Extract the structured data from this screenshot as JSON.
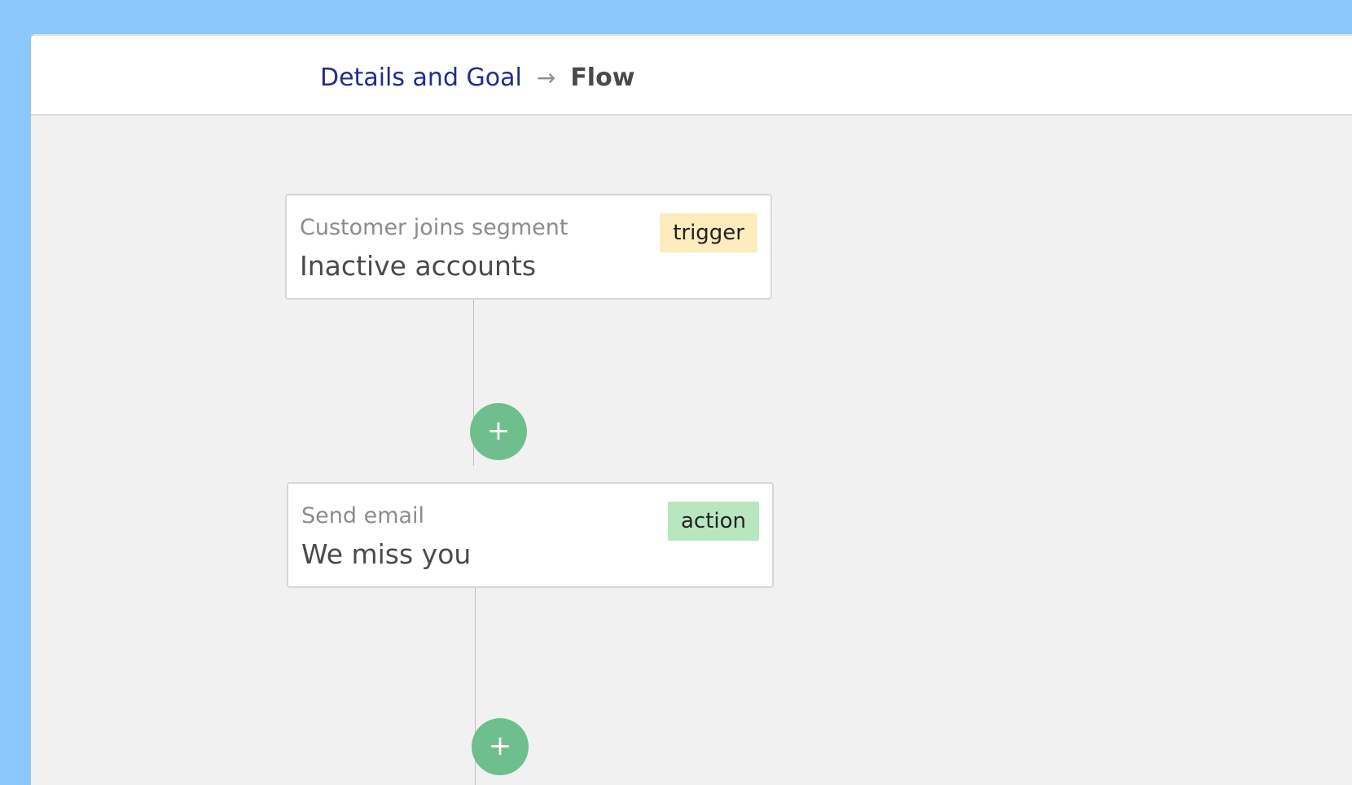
{
  "header": {
    "breadcrumb_link_label": "Details and Goal",
    "breadcrumb_arrow": "→",
    "breadcrumb_current_label": "Flow"
  },
  "flow": {
    "add_step_glyph": "+",
    "nodes": [
      {
        "title": "Customer joins segment",
        "subtitle": "Inactive accounts",
        "badge": "trigger"
      },
      {
        "title": "Send email",
        "subtitle": "We miss you",
        "badge": "action"
      }
    ]
  },
  "colors": {
    "desktop_background": "#8cc8fb",
    "canvas_background": "#f1f1f1",
    "breadcrumb_link": "#1f2d8d",
    "trigger_badge": "#fcecbe",
    "action_badge": "#b7e7bf",
    "add_button": "#6fbe8d"
  },
  "icons": {
    "breadcrumb_separator": "arrow-right-icon",
    "add_step": "plus-icon"
  }
}
